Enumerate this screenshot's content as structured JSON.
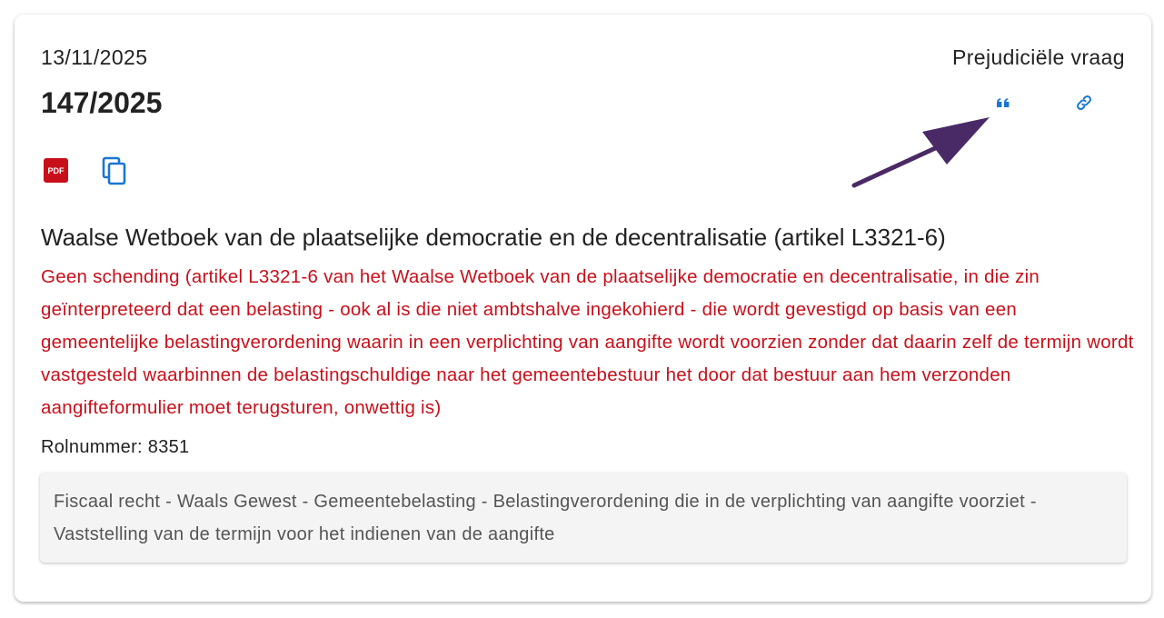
{
  "card": {
    "date": "13/11/2025",
    "type": "Prejudiciële vraag",
    "number": "147/2025",
    "actions": {
      "quote_icon": "quote-icon",
      "link_icon": "link-icon",
      "pdf_label": "PDF",
      "copy_icon": "copy-icon"
    },
    "law_title": "Waalse Wetboek van de plaatselijke democratie en de decentralisatie (artikel L3321-6)",
    "decision": "Geen schending (artikel L3321-6 van het Waalse Wetboek van de plaatselijke democratie en decentralisatie, in die zin geïnterpreteerd dat een belasting - ook al is die niet ambtshalve ingekohierd - die wordt gevestigd op basis van een gemeentelijke belastingverordening waarin in een verplichting van aangifte wordt voorzien zonder dat daarin zelf de termijn wordt vastgesteld waarbinnen de belastingschuldige naar het gemeentebestuur het door dat bestuur aan hem verzonden aangifteformulier moet terugsturen, onwettig is)",
    "rolnummer": "Rolnummer: 8351",
    "keywords": "Fiscaal recht - Waals Gewest - Gemeentebelasting - Belastingverordening die in de verplichting van aangifte voorziet - Vaststelling van de termijn voor het indienen van de aangifte"
  },
  "colors": {
    "accent_blue": "#1976d2",
    "decision_red": "#c8101b",
    "pdf_red": "#c8101b",
    "annotation_arrow": "#4a2a66"
  }
}
